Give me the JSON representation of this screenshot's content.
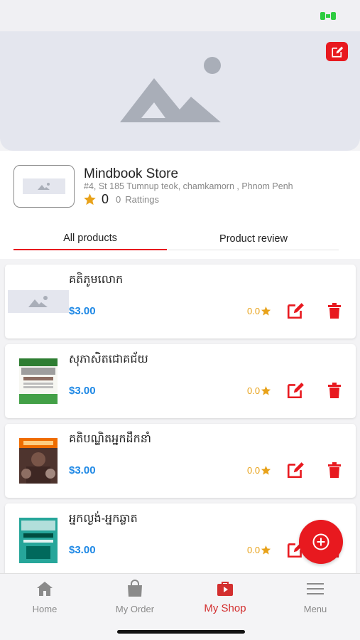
{
  "store": {
    "name": "Mindbook Store",
    "address": "#4, St 185 Tumnup teok, chamkamorn , Phnom Penh",
    "rating": "0",
    "rating_count": "0",
    "rating_label": "Rattings"
  },
  "tabs": [
    {
      "label": "All products",
      "active": true
    },
    {
      "label": "Product review",
      "active": false
    }
  ],
  "products": [
    {
      "name": "គតិភូមលោក",
      "price": "$3.00",
      "rating": "0.0"
    },
    {
      "name": "សុភាសិតជោគជ័យ",
      "price": "$3.00",
      "rating": "0.0"
    },
    {
      "name": "គតិបណ្ឌិតអ្នកដឹកនាំ",
      "price": "$3.00",
      "rating": "0.0"
    },
    {
      "name": "អ្នកល្ងង់-អ្នកឆ្លាត",
      "price": "$3.00",
      "rating": "0.0"
    }
  ],
  "nav": [
    {
      "label": "Home",
      "icon": "home-icon",
      "active": false
    },
    {
      "label": "My Order",
      "icon": "shopping-bag-icon",
      "active": false
    },
    {
      "label": "My Shop",
      "icon": "shop-icon",
      "active": true
    },
    {
      "label": "Menu",
      "icon": "menu-icon",
      "active": false
    }
  ],
  "colors": {
    "accent": "#e8191f",
    "price": "#1e88e5",
    "star": "#e8a21a",
    "cover_bg": "#e4e6ee"
  }
}
